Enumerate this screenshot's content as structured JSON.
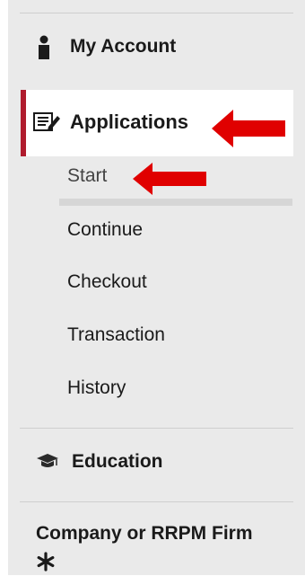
{
  "sidebar": {
    "my_account": {
      "label": "My Account",
      "icon": "person-icon"
    },
    "applications": {
      "label": "Applications",
      "icon": "form-edit-icon",
      "active_color": "#b01c2e",
      "sub_items": [
        "Start",
        "Continue",
        "Checkout",
        "Transaction",
        "History"
      ],
      "selected_sub_item": "Start"
    },
    "education": {
      "label": "Education",
      "icon": "graduation-cap-icon"
    },
    "company": {
      "label": "Company or RRPM Firm",
      "icon": "asterisk-icon"
    }
  },
  "annotations": {
    "arrow_color": "#e00000",
    "arrows": [
      "arrow-pointing-left",
      "arrow-pointing-left"
    ]
  }
}
